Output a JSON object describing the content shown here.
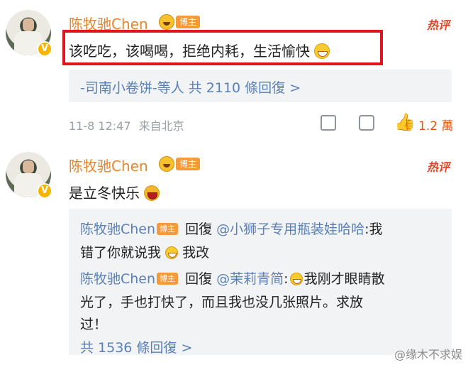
{
  "comment1": {
    "username": "陈牧驰Chen",
    "badge_tag": "博主",
    "hot_tag": "热评",
    "text": "该吃吃，该喝喝，拒绝内耗，生活愉快",
    "reply_summary": "-司南小卷饼-等人 共 2110 條回復 >",
    "timestamp": "11-8 12:47",
    "location": "来自北京",
    "like_count": "1.2 萬"
  },
  "comment2": {
    "username": "陈牧驰Chen",
    "badge_tag": "博主",
    "hot_tag": "热评",
    "text": "是立冬快乐",
    "replies": [
      {
        "name": "陈牧驰Chen",
        "tag": "博主",
        "prefix": " 回復 ",
        "mention": "@小狮子专用瓶装娃哈哈",
        "line1_text": ":我",
        "line2_text": "错了你就说我",
        "line2_tail": "我改"
      },
      {
        "name": "陈牧驰Chen",
        "tag": "博主",
        "prefix": " 回復 ",
        "mention": "@茉莉青简",
        "line1_text": ":",
        "line1_tail": "我刚才眼睛散",
        "line2_text": "光了，手也打快了，而且我也没几张照片。求放",
        "line3_text": "过！"
      }
    ],
    "total_replies": "共 1536 條回復 >"
  },
  "watermark": "@缘木不求娱",
  "icons": {
    "share": "share-icon",
    "comment": "comment-icon",
    "like": "thumbs-up-icon"
  },
  "colors": {
    "username": "#e8852a",
    "link": "#5a80b8",
    "highlight": "#e0141f",
    "like": "#e8520f"
  }
}
